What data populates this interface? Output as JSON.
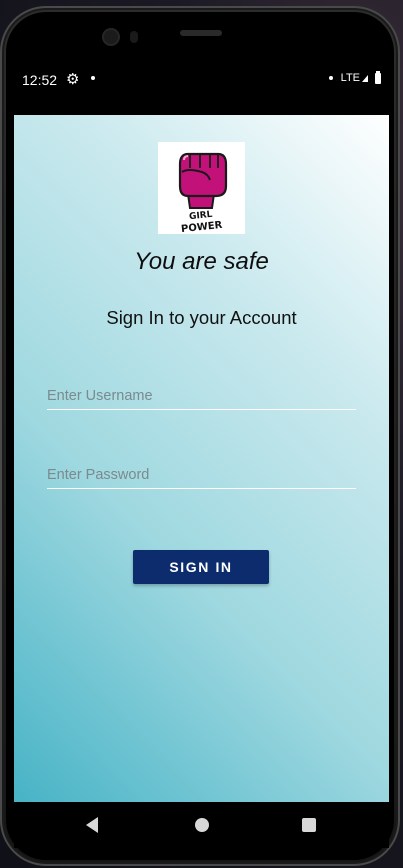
{
  "status_bar": {
    "time": "12:52",
    "network": "LTE",
    "icons": [
      "settings-gear-icon",
      "notification-dot-icon",
      "signal-icon",
      "battery-icon"
    ]
  },
  "screen": {
    "background_gradient": [
      "#ffffff",
      "#c9e9ee",
      "#9fd8e0",
      "#47b3c6"
    ],
    "logo": {
      "icon": "girl-power-fist-logo",
      "text": "GIRL POWER"
    },
    "title": "You are safe",
    "subtitle": "Sign In to your Account",
    "username": {
      "value": "",
      "placeholder": "Enter Username"
    },
    "password": {
      "value": "",
      "placeholder": "Enter Password"
    },
    "sign_in_label": "SIGN IN",
    "button_color": "#0c2c6d"
  },
  "nav_bar": {
    "icons": [
      "back-icon",
      "home-icon",
      "recents-icon"
    ]
  }
}
